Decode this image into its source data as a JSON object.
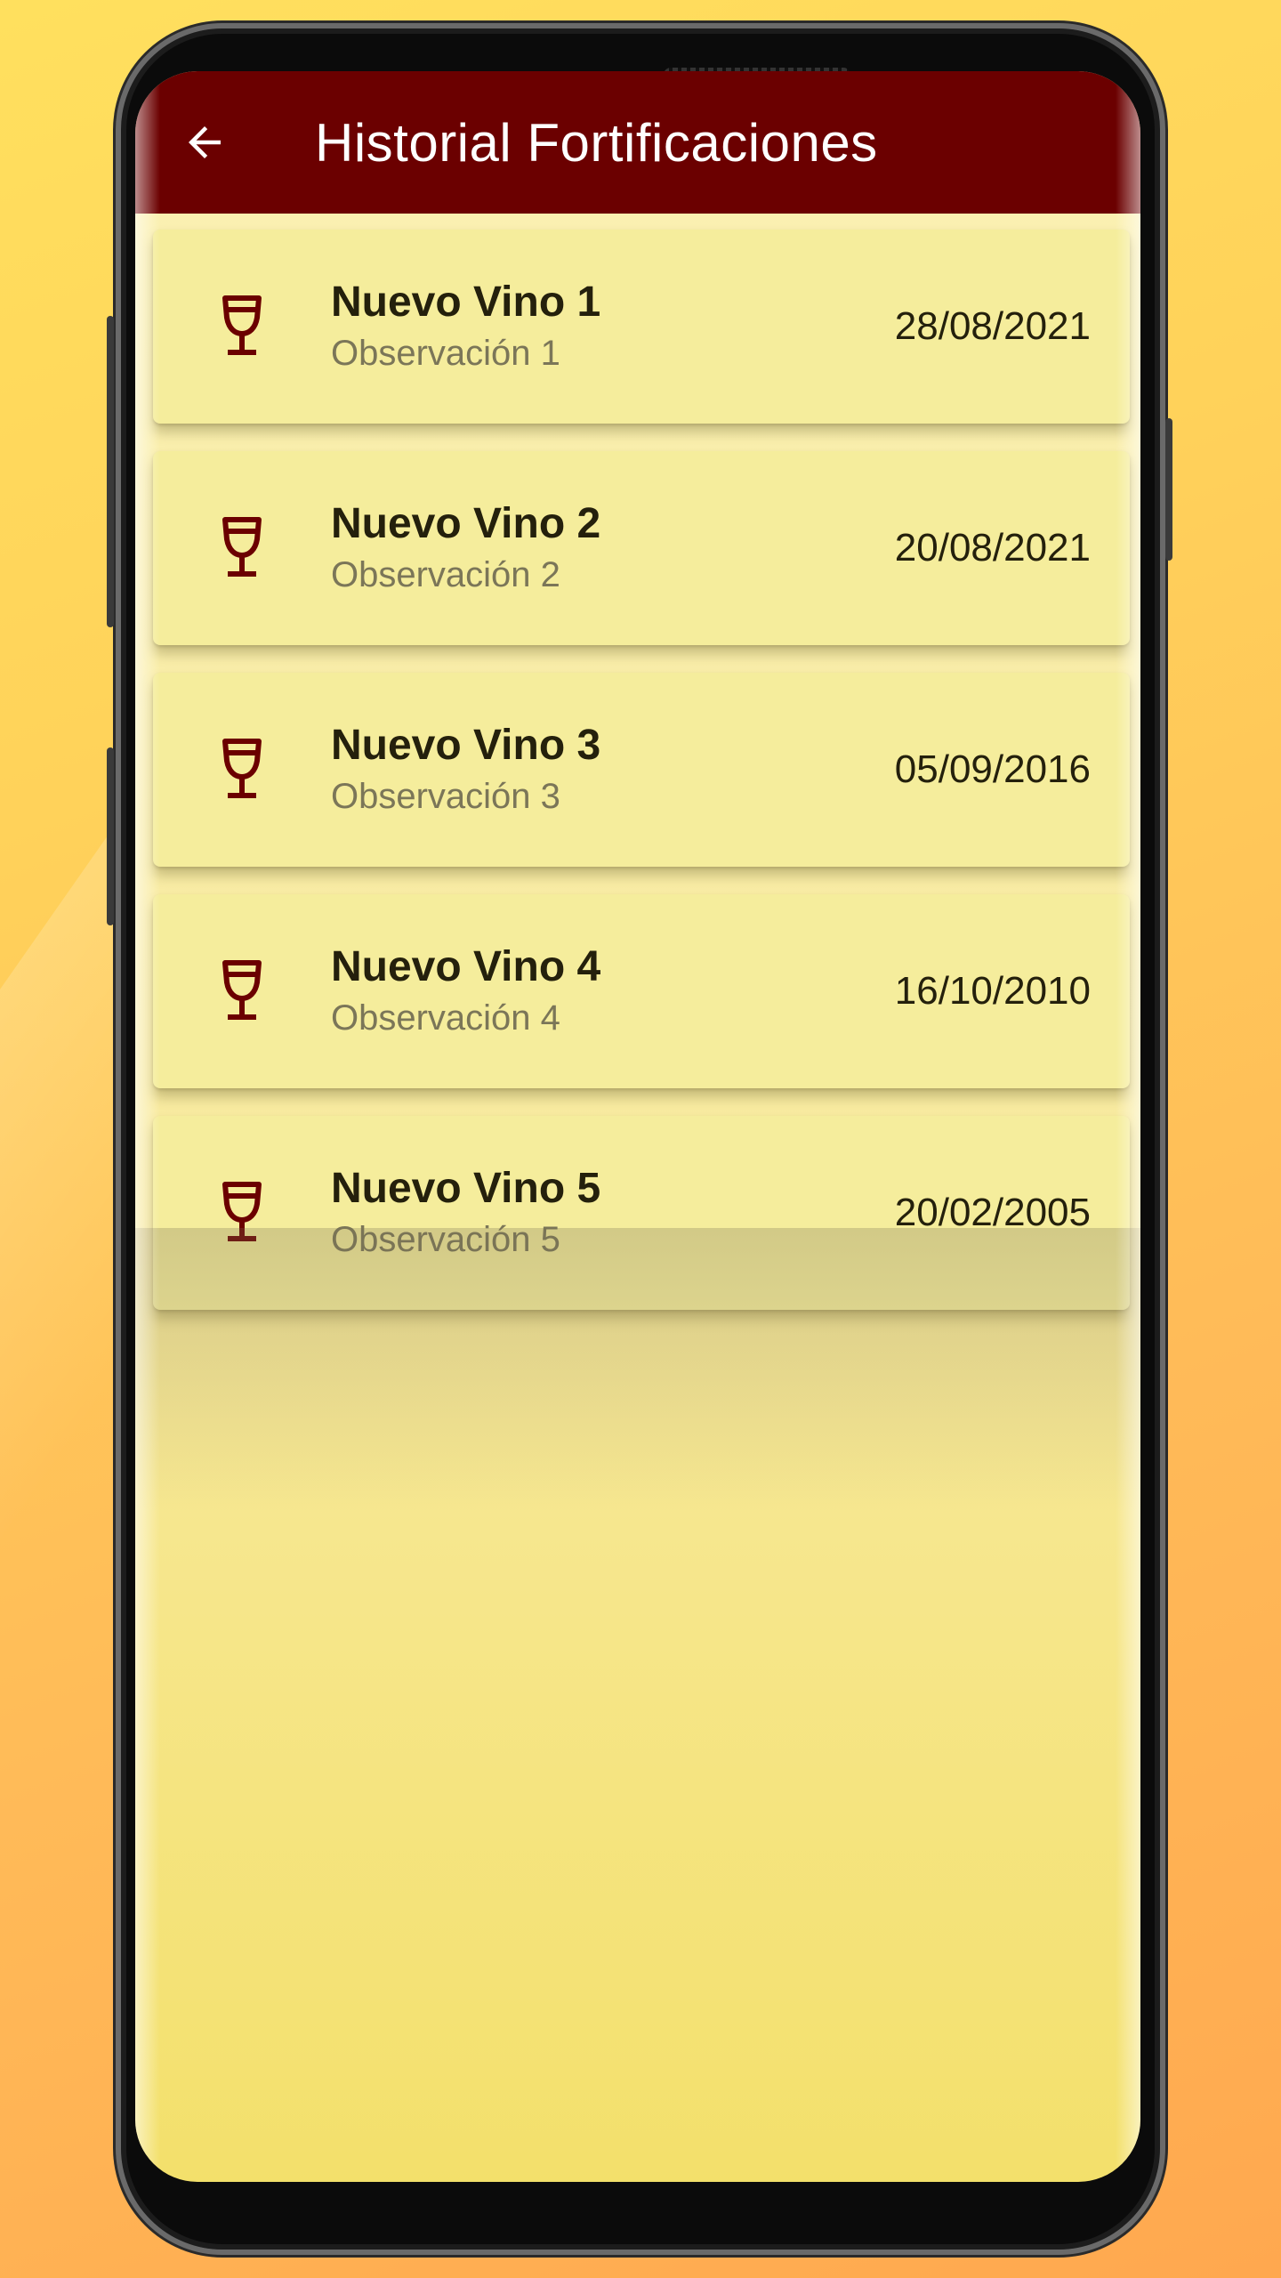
{
  "appbar": {
    "title": "Historial Fortificaciones",
    "back_icon": "arrow-left-icon",
    "background_color": "#6b0000"
  },
  "list": {
    "item_icon": "wine-glass-icon",
    "items": [
      {
        "name": "Nuevo Vino 1",
        "observation": "Observación 1",
        "date": "28/08/2021"
      },
      {
        "name": "Nuevo Vino 2",
        "observation": "Observación 2",
        "date": "20/08/2021"
      },
      {
        "name": "Nuevo Vino 3",
        "observation": "Observación 3",
        "date": "05/09/2016"
      },
      {
        "name": "Nuevo Vino 4",
        "observation": "Observación 4",
        "date": "16/10/2010"
      },
      {
        "name": "Nuevo Vino 5",
        "observation": "Observación 5",
        "date": "20/02/2005"
      }
    ]
  },
  "colors": {
    "accent": "#6b0000",
    "card": "#f5ed9c",
    "text_primary": "#24200c",
    "text_secondary": "#7b7658"
  }
}
